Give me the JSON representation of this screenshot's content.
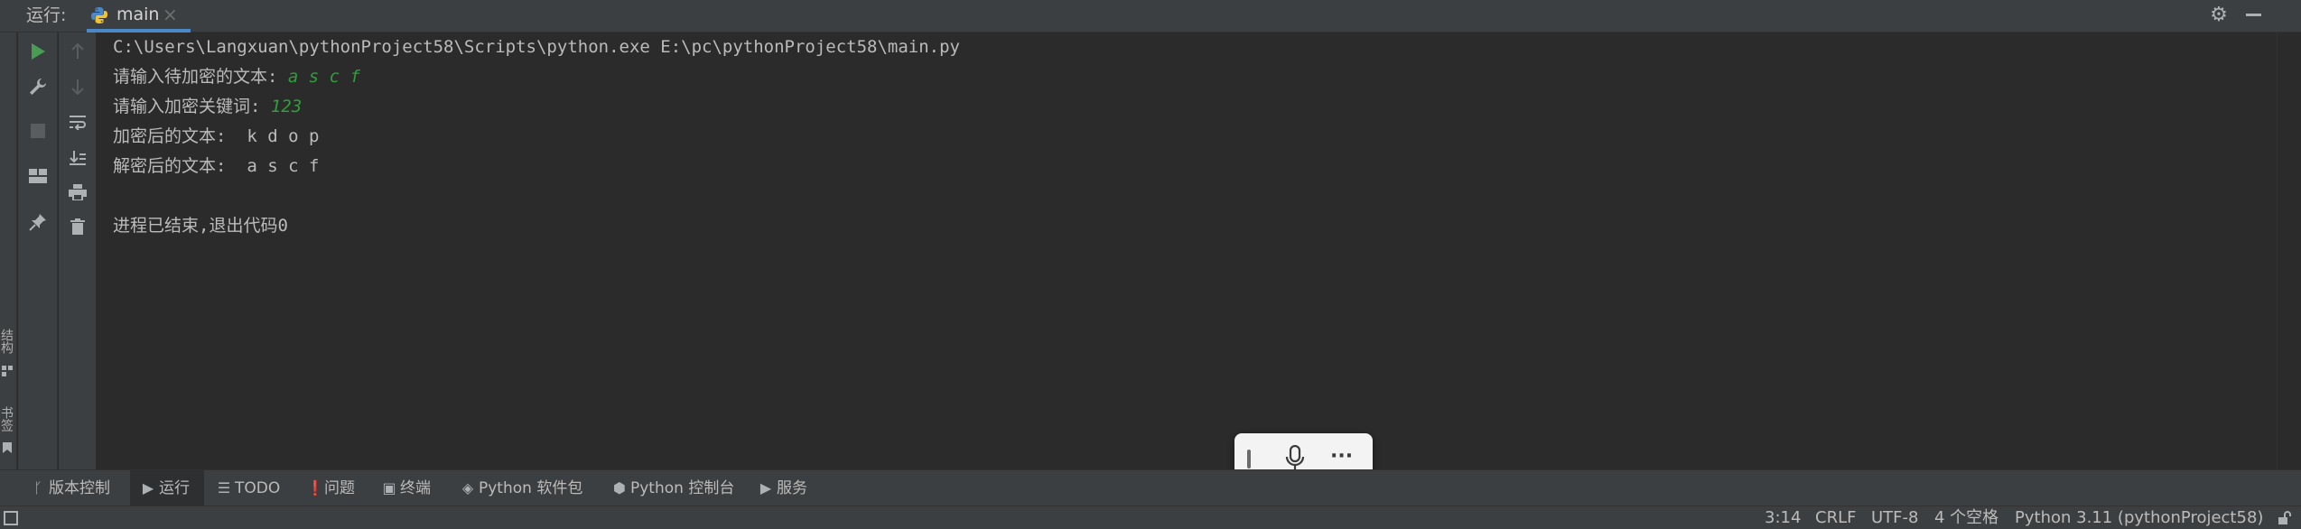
{
  "header": {
    "run_label": "运行:",
    "tab_label": "main",
    "tab_close": "×"
  },
  "left_strip": {
    "structure_label": "结构",
    "bookmarks_label": "书签"
  },
  "console": {
    "lines": [
      {
        "text": "C:\\Users\\Langxuan\\pythonProject58\\Scripts\\python.exe E:\\pc\\pythonProject58\\main.py",
        "input": ""
      },
      {
        "text": "请输入待加密的文本: ",
        "input": "a s c f"
      },
      {
        "text": "请输入加密关键词: ",
        "input": "123"
      },
      {
        "text": "加密后的文本:  k d o p",
        "input": ""
      },
      {
        "text": "解密后的文本:  a s c f",
        "input": ""
      },
      {
        "text": "",
        "input": ""
      },
      {
        "text": "进程已结束,退出代码0",
        "input": ""
      }
    ]
  },
  "voicebar": {
    "more": "···"
  },
  "tool_windows": [
    {
      "icon": "version-control-icon",
      "label": "版本控制"
    },
    {
      "icon": "run-icon",
      "label": "运行"
    },
    {
      "icon": "todo-icon",
      "label": "TODO"
    },
    {
      "icon": "problems-icon",
      "label": "问题"
    },
    {
      "icon": "terminal-icon",
      "label": "终端"
    },
    {
      "icon": "python-packages-icon",
      "label": "Python 软件包"
    },
    {
      "icon": "python-console-icon",
      "label": "Python 控制台"
    },
    {
      "icon": "services-icon",
      "label": "服务"
    }
  ],
  "status": {
    "position": "3:14",
    "line_separator": "CRLF",
    "encoding": "UTF-8",
    "indent": "4 个空格",
    "interpreter": "Python 3.11 (pythonProject58)"
  },
  "colors": {
    "accent": "#4a88c7",
    "run_green": "#499c54",
    "input_green": "#2e9f3a",
    "panel": "#3c3f41",
    "console_bg": "#2b2b2b"
  }
}
